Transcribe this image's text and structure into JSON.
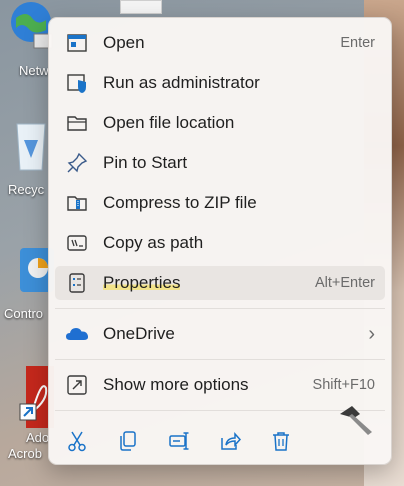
{
  "desktop": {
    "icons": [
      {
        "name": "network",
        "label": "Netw"
      },
      {
        "name": "recycle-bin",
        "label": "Recyc"
      },
      {
        "name": "control-panel",
        "label": "Contro"
      },
      {
        "name": "adobe-acrobat",
        "label": "Ado",
        "label2": "Acrob"
      }
    ]
  },
  "context_menu": {
    "items": [
      {
        "label": "Open",
        "shortcut": "Enter",
        "icon": "open-app-icon"
      },
      {
        "label": "Run as administrator",
        "shortcut": "",
        "icon": "shield-icon"
      },
      {
        "label": "Open file location",
        "shortcut": "",
        "icon": "folder-icon"
      },
      {
        "label": "Pin to Start",
        "shortcut": "",
        "icon": "pin-icon"
      },
      {
        "label": "Compress to ZIP file",
        "shortcut": "",
        "icon": "zip-icon"
      },
      {
        "label": "Copy as path",
        "shortcut": "",
        "icon": "copy-path-icon"
      },
      {
        "label": "Properties",
        "shortcut": "Alt+Enter",
        "icon": "properties-icon"
      },
      {
        "label": "OneDrive",
        "shortcut": "",
        "icon": "onedrive-icon",
        "submenu_arrow": "›"
      },
      {
        "label": "Show more options",
        "shortcut": "Shift+F10",
        "icon": "more-options-icon"
      }
    ],
    "highlighted_item": "Properties",
    "bottom_actions": [
      "cut",
      "copy",
      "rename",
      "share",
      "delete"
    ]
  },
  "colors": {
    "accent_blue": "#1a73c8",
    "highlight_marker": "#f2e38a",
    "onedrive_blue": "#1f6fd1",
    "acrobat_red": "#c5281c"
  }
}
